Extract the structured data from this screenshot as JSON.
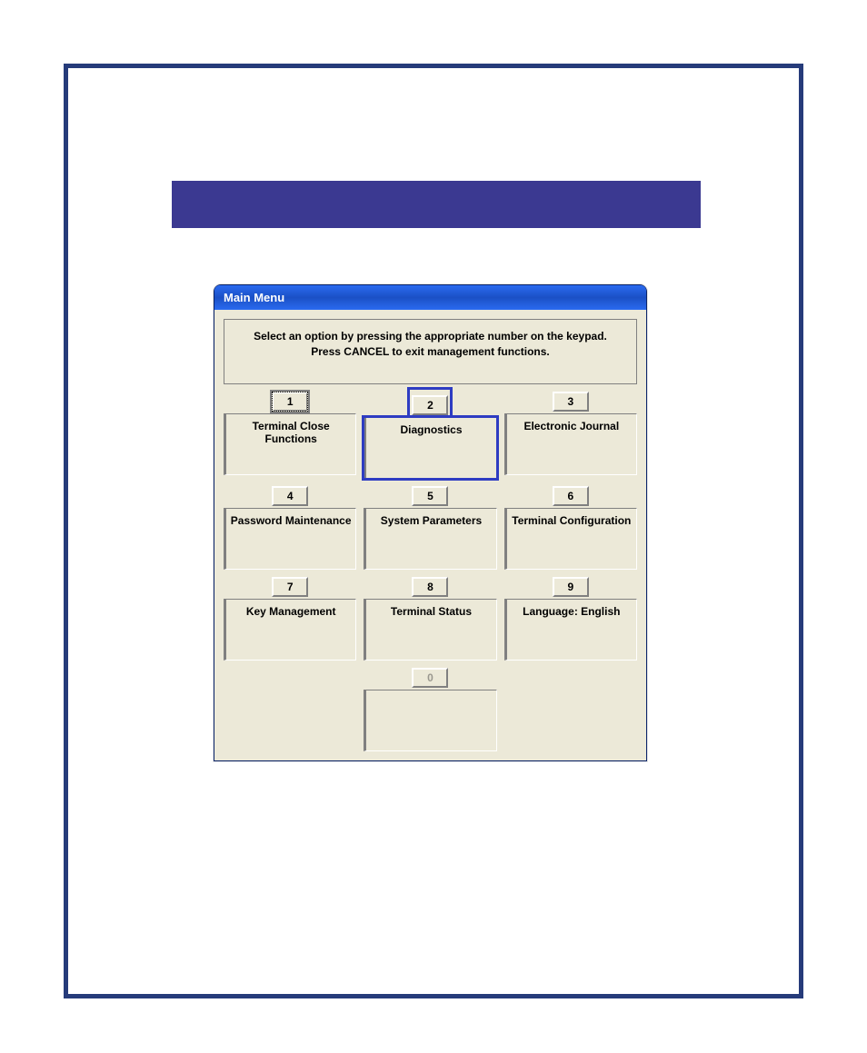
{
  "window": {
    "title": "Main Menu",
    "instructions_line1": "Select an option by pressing the appropriate number on the keypad.",
    "instructions_line2": "Press CANCEL to exit management functions."
  },
  "menu": {
    "items": [
      {
        "num": "1",
        "label": "Terminal Close Functions",
        "selected": true,
        "highlighted": false
      },
      {
        "num": "2",
        "label": "Diagnostics",
        "selected": false,
        "highlighted": true
      },
      {
        "num": "3",
        "label": "Electronic Journal",
        "selected": false,
        "highlighted": false
      },
      {
        "num": "4",
        "label": "Password Maintenance",
        "selected": false,
        "highlighted": false
      },
      {
        "num": "5",
        "label": "System Parameters",
        "selected": false,
        "highlighted": false
      },
      {
        "num": "6",
        "label": "Terminal Configuration",
        "selected": false,
        "highlighted": false
      },
      {
        "num": "7",
        "label": "Key Management",
        "selected": false,
        "highlighted": false
      },
      {
        "num": "8",
        "label": "Terminal Status",
        "selected": false,
        "highlighted": false
      },
      {
        "num": "9",
        "label": "Language: English",
        "selected": false,
        "highlighted": false
      }
    ],
    "zero": {
      "num": "0",
      "label": "",
      "disabled": true
    }
  }
}
